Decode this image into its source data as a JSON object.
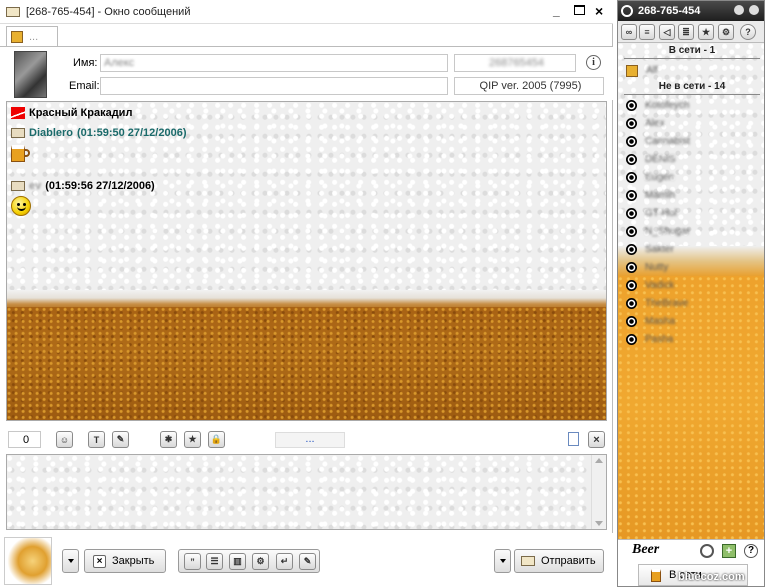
{
  "window": {
    "title": "[268-765-454] - Окно сообщений",
    "tab_label": "...",
    "controls": [
      "_",
      "□",
      "×"
    ]
  },
  "contact_info": {
    "name_label": "Имя:",
    "name_value": "Алекс",
    "email_label": "Email:",
    "email_value": "",
    "uin_value": "268765454",
    "client_version": "QIP ver. 2005 (7995)"
  },
  "chat": {
    "header_name": "Красный Кракадил",
    "messages": [
      {
        "author": "Diablero",
        "timestamp": "(01:59:50 27/12/2006)",
        "emoticon": "beer-mug-icon"
      },
      {
        "author": "ev",
        "timestamp": "(01:59:56 27/12/2006)",
        "emoticon": "smiley-icon"
      }
    ]
  },
  "input_bar": {
    "counter": "0",
    "status_dots": "..."
  },
  "bottom": {
    "close_label": "Закрыть",
    "send_label": "Отправить"
  },
  "contact_list": {
    "uin": "268-765-454",
    "online_header": "В сети - 1",
    "online_contacts": [
      "Alf"
    ],
    "offline_header": "Не в сети - 14",
    "offline_contacts": [
      "Kotofeych",
      "Alex",
      "Cannabist",
      "DENIS",
      "Eugen",
      "Mamih",
      "GT-Hol",
      "N_Shugar",
      "Sakter",
      "Nutty",
      "Vadick",
      "TheBrave",
      "Masha",
      "Pasha"
    ],
    "footer_logo": "Beer",
    "status_label": "В сети"
  },
  "watermark": "bluecoz.com"
}
